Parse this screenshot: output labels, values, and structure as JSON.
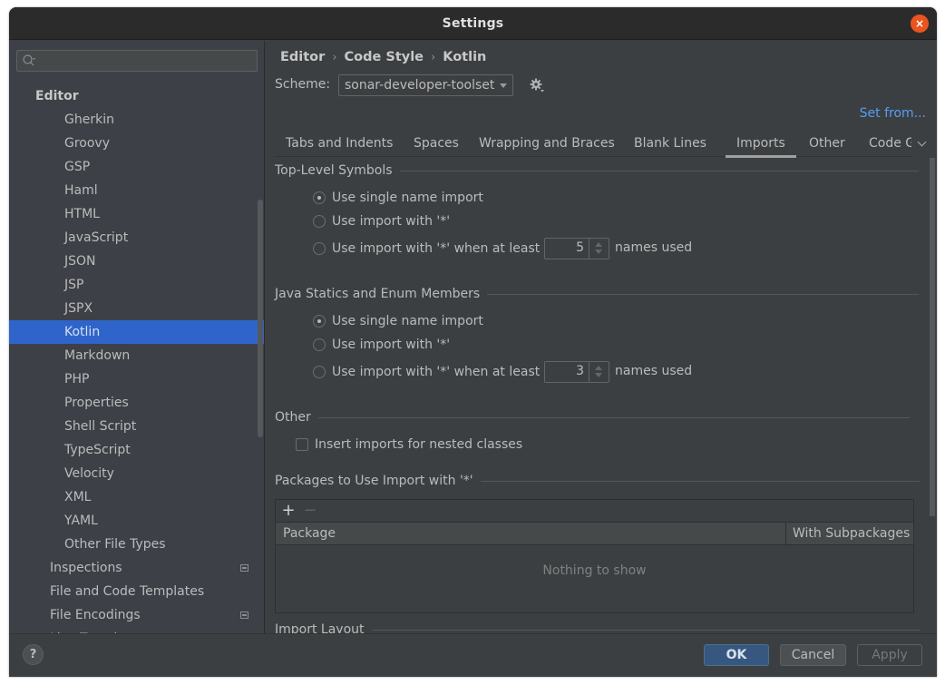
{
  "window": {
    "title": "Settings",
    "close_label": "×"
  },
  "sidebar": {
    "search_placeholder": "",
    "items": [
      {
        "label": "Editor",
        "level": 0
      },
      {
        "label": "Gherkin",
        "level": 2
      },
      {
        "label": "Groovy",
        "level": 2
      },
      {
        "label": "GSP",
        "level": 2
      },
      {
        "label": "Haml",
        "level": 2
      },
      {
        "label": "HTML",
        "level": 2
      },
      {
        "label": "JavaScript",
        "level": 2
      },
      {
        "label": "JSON",
        "level": 2
      },
      {
        "label": "JSP",
        "level": 2
      },
      {
        "label": "JSPX",
        "level": 2
      },
      {
        "label": "Kotlin",
        "level": 2,
        "selected": true
      },
      {
        "label": "Markdown",
        "level": 2
      },
      {
        "label": "PHP",
        "level": 2
      },
      {
        "label": "Properties",
        "level": 2
      },
      {
        "label": "Shell Script",
        "level": 2
      },
      {
        "label": "TypeScript",
        "level": 2
      },
      {
        "label": "Velocity",
        "level": 2
      },
      {
        "label": "XML",
        "level": 2
      },
      {
        "label": "YAML",
        "level": 2
      },
      {
        "label": "Other File Types",
        "level": 2
      },
      {
        "label": "Inspections",
        "level": 1,
        "badge": true
      },
      {
        "label": "File and Code Templates",
        "level": 1
      },
      {
        "label": "File Encodings",
        "level": 1,
        "badge": true
      },
      {
        "label": "Live Templates",
        "level": 1
      }
    ]
  },
  "breadcrumb": [
    "Editor",
    "Code Style",
    "Kotlin"
  ],
  "breadcrumb_separator": "›",
  "scheme": {
    "label": "Scheme:",
    "value": "sonar-developer-toolset"
  },
  "set_from": "Set from...",
  "tabs": [
    {
      "label": "Tabs and Indents"
    },
    {
      "label": "Spaces"
    },
    {
      "label": "Wrapping and Braces"
    },
    {
      "label": "Blank Lines"
    },
    {
      "label": "Imports",
      "active": true
    },
    {
      "label": "Other"
    },
    {
      "label": "Code G"
    }
  ],
  "top_level": {
    "title": "Top-Level Symbols",
    "options": [
      {
        "label": "Use single name import",
        "checked": true
      },
      {
        "label": "Use import with '*'",
        "checked": false
      },
      {
        "label": "Use import with '*' when at least",
        "checked": false
      }
    ],
    "count": "5",
    "suffix": "names used"
  },
  "java_statics": {
    "title": "Java Statics and Enum Members",
    "options": [
      {
        "label": "Use single name import",
        "checked": true
      },
      {
        "label": "Use import with '*'",
        "checked": false
      },
      {
        "label": "Use import with '*' when at least",
        "checked": false
      }
    ],
    "count": "3",
    "suffix": "names used"
  },
  "other": {
    "title": "Other",
    "checkbox_label": "Insert imports for nested classes",
    "checked": false
  },
  "packages": {
    "title": "Packages to Use Import with '*'",
    "add_label": "+",
    "remove_label": "−",
    "columns": [
      "Package",
      "With Subpackages"
    ],
    "empty_text": "Nothing to show"
  },
  "import_layout": {
    "title": "Import Layout"
  },
  "footer": {
    "help_label": "?",
    "ok": "OK",
    "cancel": "Cancel",
    "apply": "Apply"
  },
  "colors": {
    "accent": "#2f65ca",
    "link": "#589df6",
    "ok_button": "#365880",
    "close": "#e95420"
  }
}
